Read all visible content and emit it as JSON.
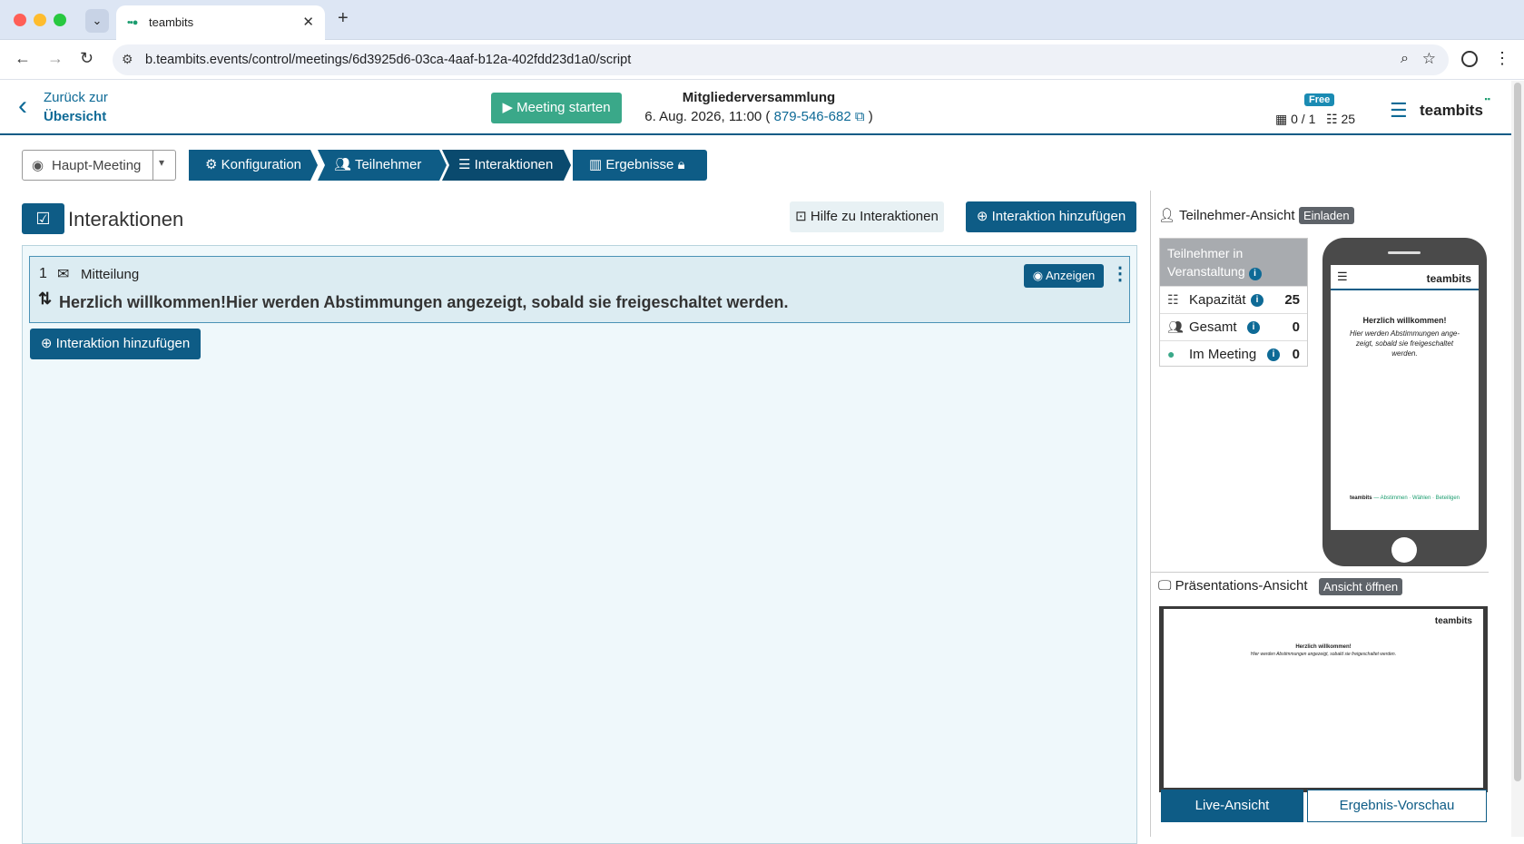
{
  "browser": {
    "tab_title": "teambits",
    "url": "b.teambits.events/control/meetings/6d3925d6-03ca-4aaf-b12a-402fdd23d1a0/script"
  },
  "header": {
    "back_line1": "Zurück zur",
    "back_line2": "Übersicht",
    "start_button": "Meeting starten",
    "meeting_title": "Mitgliederversammlung",
    "meeting_date": "6. Aug. 2026, 11:00 (",
    "meeting_id": "879-546-682",
    "meeting_date_close": ")",
    "plan_badge": "Free",
    "room_count": "0 / 1",
    "capacity": "25",
    "logo": "teambits"
  },
  "toolbar": {
    "meeting_select": "Haupt-Meeting",
    "steps": [
      "Konfiguration",
      "Teilnehmer",
      "Interaktionen",
      "Ergebnisse"
    ]
  },
  "section": {
    "title": "Interaktionen",
    "help_button": "Hilfe zu Interaktionen",
    "add_button": "Interaktion hinzufügen"
  },
  "interactions": [
    {
      "number": "1",
      "type": "Mitteilung",
      "text": "Herzlich willkommen!Hier werden Abstimmungen angezeigt, sobald sie freigeschaltet werden.",
      "show_button": "Anzeigen"
    }
  ],
  "add_bottom_button": "Interaktion hinzufügen",
  "participant_view": {
    "title": "Teilnehmer-Ansicht",
    "invite": "Einladen",
    "stats_header": "Teilnehmer in Veranstaltung",
    "rows": [
      {
        "label": "Kapazität",
        "value": "25"
      },
      {
        "label": "Gesamt",
        "value": "0"
      },
      {
        "label": "Im Meeting",
        "value": "0"
      }
    ],
    "phone": {
      "logo": "teambits",
      "heading": "Herzlich willkommen!",
      "body": "Hier werden Abstimmungen ange-zeigt, sobald sie freigeschaltet werden.",
      "footer_brand": "teambits",
      "footer_tagline": "— Abstimmen · Wählen · Beteiligen"
    }
  },
  "presentation_view": {
    "title": "Präsentations-Ansicht",
    "open": "Ansicht öffnen",
    "logo": "teambits",
    "heading": "Herzlich willkommen!",
    "body": "Hier werden Abstimmungen angezeigt, sobald sie freigeschaltet werden.",
    "tab_live": "Live-Ansicht",
    "tab_preview": "Ergebnis-Vorschau"
  },
  "colors": {
    "primary": "#0e5c86",
    "start": "#3aa889",
    "active_step": "#0a4a6e"
  }
}
